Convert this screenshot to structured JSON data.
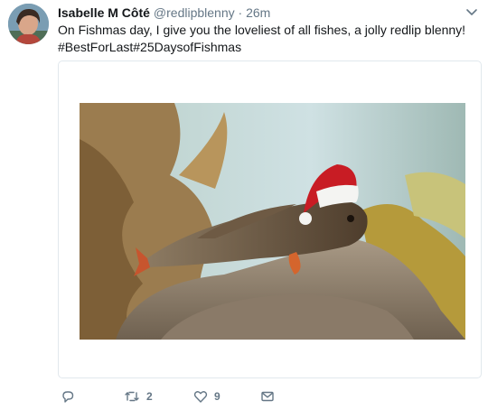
{
  "tweet": {
    "author": {
      "display_name": "Isabelle M Côté",
      "handle": "@redlipblenny",
      "separator": "·",
      "time": "26m"
    },
    "text_lines": [
      "On Fishmas day, I give you the loveliest of all fishes, a jolly redlip blenny!",
      "#BestForLast#25DaysofFishmas"
    ],
    "actions": {
      "reply_icon": "reply-icon",
      "retweet_icon": "retweet-icon",
      "retweet_count": "2",
      "like_icon": "heart-icon",
      "like_count": "9",
      "message_icon": "envelope-icon"
    },
    "menu_icon": "chevron-down-icon"
  },
  "colors": {
    "secondary_text": "#657786",
    "primary_text": "#14171a",
    "card_border": "#e1e8ed"
  }
}
